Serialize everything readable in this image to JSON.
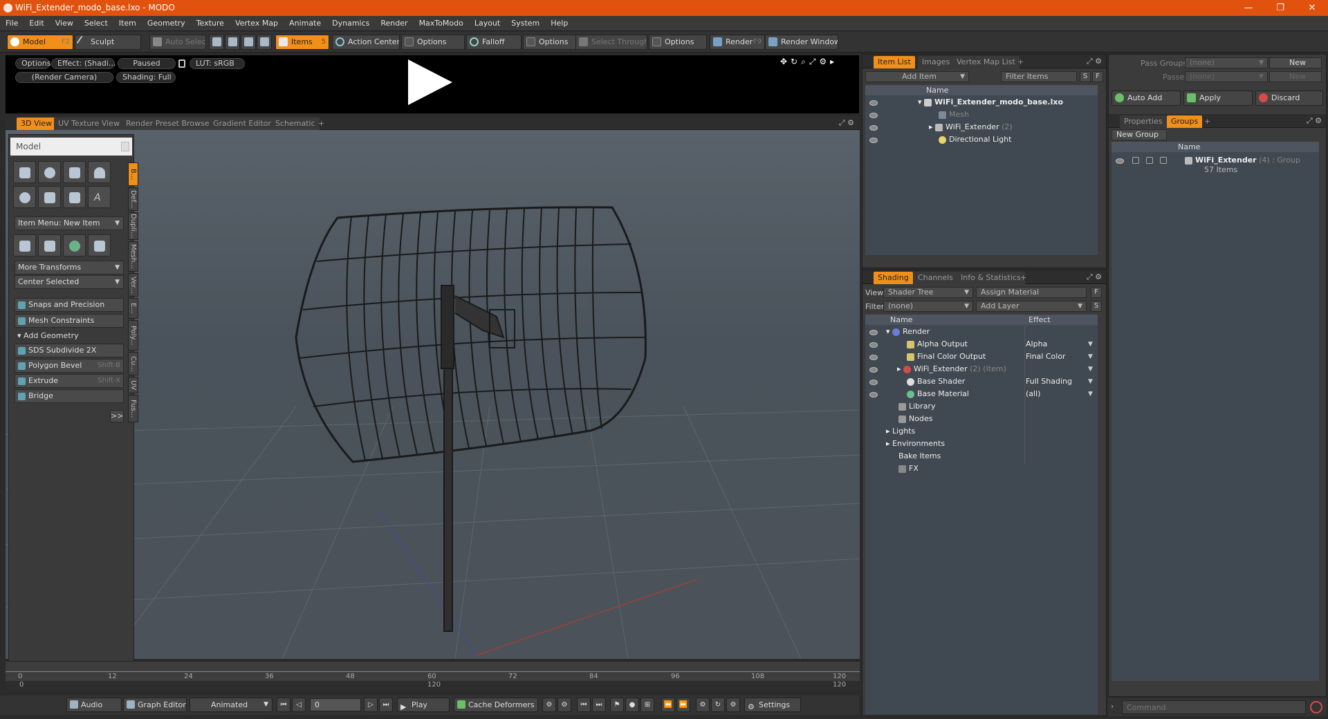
{
  "window": {
    "title": "WiFi_Extender_modo_base.lxo - MODO",
    "min": "—",
    "max": "❐",
    "close": "✕"
  },
  "menu": [
    "File",
    "Edit",
    "View",
    "Select",
    "Item",
    "Geometry",
    "Texture",
    "Vertex Map",
    "Animate",
    "Dynamics",
    "Render",
    "MaxToModo",
    "Layout",
    "System",
    "Help"
  ],
  "toolbar": {
    "model": "Model",
    "model_key": "F2",
    "sculpt": "Sculpt",
    "auto_select": "Auto Select",
    "items": "Items",
    "items_key": "5",
    "action_center": "Action Center",
    "options1": "Options",
    "falloff": "Falloff",
    "options2": "Options",
    "select_through": "Select Through",
    "options3": "Options",
    "render": "Render",
    "render_key": "F9",
    "render_window": "Render Window"
  },
  "render_preview": {
    "options": "Options",
    "effect": "Effect: (Shadi...",
    "paused": "Paused",
    "lut": "LUT: sRGB",
    "camera": "(Render Camera)",
    "shading": "Shading: Full"
  },
  "view_tabs": [
    "3D View",
    "UV Texture View",
    "Render Preset Browser",
    "Gradient Editor",
    "Schematic",
    "+"
  ],
  "tool_panel": {
    "title": "Model",
    "item_menu": "Item Menu: New Item",
    "more_transforms": "More Transforms",
    "center_selected": "Center Selected",
    "snaps": "Snaps and Precision",
    "mesh_constraints": "Mesh Constraints",
    "add_geometry": "Add Geometry",
    "sds": "SDS Subdivide 2X",
    "polygon_bevel": "Polygon Bevel",
    "polygon_bevel_key": "Shift-B",
    "extrude": "Extrude",
    "extrude_key": "Shift-X",
    "bridge": "Bridge",
    "more": ">>",
    "side_tabs": [
      "B...",
      "Def...",
      "Dupli...",
      "Mesh...",
      "Ver...",
      "E...",
      "Poly...",
      "Cu...",
      "UV",
      "Fus..."
    ]
  },
  "timeline": {
    "ticks": [
      "0",
      "12",
      "24",
      "36",
      "48",
      "60",
      "72",
      "84",
      "96",
      "108",
      "120"
    ],
    "end_label": "120",
    "mid_label": "120",
    "start_label": "0"
  },
  "transport": {
    "audio": "Audio",
    "graph_editor": "Graph Editor",
    "animated": "Animated",
    "frame": "0",
    "play": "Play",
    "cache_deformers": "Cache Deformers",
    "settings": "Settings"
  },
  "item_list": {
    "tabs": [
      "Item List",
      "Images",
      "Vertex Map List",
      "+"
    ],
    "add_item": "Add Item",
    "filter_items": "Filter Items",
    "s": "S",
    "f": "F",
    "col_name": "Name",
    "rows": [
      {
        "label": "WiFi_Extender_modo_base.lxo",
        "suffix": ""
      },
      {
        "label": "Mesh",
        "suffix": ""
      },
      {
        "label": "WiFi_Extender",
        "suffix": " (2)"
      },
      {
        "label": "Directional Light",
        "suffix": ""
      }
    ]
  },
  "shading": {
    "tabs": [
      "Shading",
      "Channels",
      "Info & Statistics",
      "+"
    ],
    "view_label": "View",
    "view_value": "Shader Tree",
    "assign_material": "Assign Material",
    "f": "F",
    "filter_label": "Filter",
    "filter_value": "(none)",
    "add_layer": "Add Layer",
    "s": "S",
    "col_name": "Name",
    "col_effect": "Effect",
    "rows": [
      {
        "name": "Render",
        "effect": "",
        "suffix": ""
      },
      {
        "name": "Alpha Output",
        "effect": "Alpha",
        "suffix": ""
      },
      {
        "name": "Final Color Output",
        "effect": "Final Color",
        "suffix": ""
      },
      {
        "name": "WiFi_Extender",
        "effect": "",
        "suffix": " (2) (Item)"
      },
      {
        "name": "Base Shader",
        "effect": "Full Shading",
        "suffix": ""
      },
      {
        "name": "Base Material",
        "effect": "(all)",
        "suffix": ""
      },
      {
        "name": "Library",
        "effect": "",
        "suffix": ""
      },
      {
        "name": "Nodes",
        "effect": "",
        "suffix": ""
      },
      {
        "name": "Lights",
        "effect": "",
        "suffix": ""
      },
      {
        "name": "Environments",
        "effect": "",
        "suffix": ""
      },
      {
        "name": "Bake Items",
        "effect": "",
        "suffix": ""
      },
      {
        "name": "FX",
        "effect": "",
        "suffix": ""
      }
    ]
  },
  "groups": {
    "pass_groups_label": "Pass Groups",
    "pass_groups_value": "(none)",
    "new": "New",
    "passes_label": "Passes",
    "passes_value": "(none)",
    "new2": "New",
    "auto_add": "Auto Add",
    "apply": "Apply",
    "discard": "Discard",
    "tabs": [
      "Properties",
      "Groups",
      "+"
    ],
    "new_group": "New Group",
    "col_name": "Name",
    "group_name": "WiFi_Extender",
    "group_meta": " (4) : Group",
    "group_items": "57 Items"
  },
  "command": {
    "placeholder": "Command"
  },
  "colors": {
    "accent": "#f08f1a",
    "titlebar": "#e0520e"
  }
}
